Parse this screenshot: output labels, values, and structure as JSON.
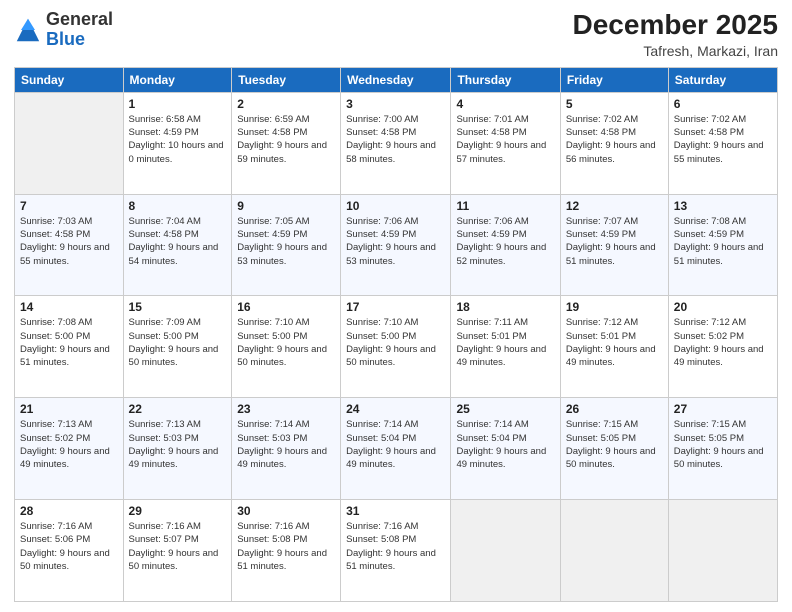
{
  "header": {
    "logo": {
      "general": "General",
      "blue": "Blue"
    },
    "title": "December 2025",
    "location": "Tafresh, Markazi, Iran"
  },
  "calendar": {
    "weekdays": [
      "Sunday",
      "Monday",
      "Tuesday",
      "Wednesday",
      "Thursday",
      "Friday",
      "Saturday"
    ],
    "weeks": [
      [
        {
          "day": "",
          "empty": true
        },
        {
          "day": "1",
          "sunrise": "6:58 AM",
          "sunset": "4:59 PM",
          "daylight": "10 hours and 0 minutes."
        },
        {
          "day": "2",
          "sunrise": "6:59 AM",
          "sunset": "4:58 PM",
          "daylight": "9 hours and 59 minutes."
        },
        {
          "day": "3",
          "sunrise": "7:00 AM",
          "sunset": "4:58 PM",
          "daylight": "9 hours and 58 minutes."
        },
        {
          "day": "4",
          "sunrise": "7:01 AM",
          "sunset": "4:58 PM",
          "daylight": "9 hours and 57 minutes."
        },
        {
          "day": "5",
          "sunrise": "7:02 AM",
          "sunset": "4:58 PM",
          "daylight": "9 hours and 56 minutes."
        },
        {
          "day": "6",
          "sunrise": "7:02 AM",
          "sunset": "4:58 PM",
          "daylight": "9 hours and 55 minutes."
        }
      ],
      [
        {
          "day": "7",
          "sunrise": "7:03 AM",
          "sunset": "4:58 PM",
          "daylight": "9 hours and 55 minutes."
        },
        {
          "day": "8",
          "sunrise": "7:04 AM",
          "sunset": "4:58 PM",
          "daylight": "9 hours and 54 minutes."
        },
        {
          "day": "9",
          "sunrise": "7:05 AM",
          "sunset": "4:59 PM",
          "daylight": "9 hours and 53 minutes."
        },
        {
          "day": "10",
          "sunrise": "7:06 AM",
          "sunset": "4:59 PM",
          "daylight": "9 hours and 53 minutes."
        },
        {
          "day": "11",
          "sunrise": "7:06 AM",
          "sunset": "4:59 PM",
          "daylight": "9 hours and 52 minutes."
        },
        {
          "day": "12",
          "sunrise": "7:07 AM",
          "sunset": "4:59 PM",
          "daylight": "9 hours and 51 minutes."
        },
        {
          "day": "13",
          "sunrise": "7:08 AM",
          "sunset": "4:59 PM",
          "daylight": "9 hours and 51 minutes."
        }
      ],
      [
        {
          "day": "14",
          "sunrise": "7:08 AM",
          "sunset": "5:00 PM",
          "daylight": "9 hours and 51 minutes."
        },
        {
          "day": "15",
          "sunrise": "7:09 AM",
          "sunset": "5:00 PM",
          "daylight": "9 hours and 50 minutes."
        },
        {
          "day": "16",
          "sunrise": "7:10 AM",
          "sunset": "5:00 PM",
          "daylight": "9 hours and 50 minutes."
        },
        {
          "day": "17",
          "sunrise": "7:10 AM",
          "sunset": "5:00 PM",
          "daylight": "9 hours and 50 minutes."
        },
        {
          "day": "18",
          "sunrise": "7:11 AM",
          "sunset": "5:01 PM",
          "daylight": "9 hours and 49 minutes."
        },
        {
          "day": "19",
          "sunrise": "7:12 AM",
          "sunset": "5:01 PM",
          "daylight": "9 hours and 49 minutes."
        },
        {
          "day": "20",
          "sunrise": "7:12 AM",
          "sunset": "5:02 PM",
          "daylight": "9 hours and 49 minutes."
        }
      ],
      [
        {
          "day": "21",
          "sunrise": "7:13 AM",
          "sunset": "5:02 PM",
          "daylight": "9 hours and 49 minutes."
        },
        {
          "day": "22",
          "sunrise": "7:13 AM",
          "sunset": "5:03 PM",
          "daylight": "9 hours and 49 minutes."
        },
        {
          "day": "23",
          "sunrise": "7:14 AM",
          "sunset": "5:03 PM",
          "daylight": "9 hours and 49 minutes."
        },
        {
          "day": "24",
          "sunrise": "7:14 AM",
          "sunset": "5:04 PM",
          "daylight": "9 hours and 49 minutes."
        },
        {
          "day": "25",
          "sunrise": "7:14 AM",
          "sunset": "5:04 PM",
          "daylight": "9 hours and 49 minutes."
        },
        {
          "day": "26",
          "sunrise": "7:15 AM",
          "sunset": "5:05 PM",
          "daylight": "9 hours and 50 minutes."
        },
        {
          "day": "27",
          "sunrise": "7:15 AM",
          "sunset": "5:05 PM",
          "daylight": "9 hours and 50 minutes."
        }
      ],
      [
        {
          "day": "28",
          "sunrise": "7:16 AM",
          "sunset": "5:06 PM",
          "daylight": "9 hours and 50 minutes."
        },
        {
          "day": "29",
          "sunrise": "7:16 AM",
          "sunset": "5:07 PM",
          "daylight": "9 hours and 50 minutes."
        },
        {
          "day": "30",
          "sunrise": "7:16 AM",
          "sunset": "5:08 PM",
          "daylight": "9 hours and 51 minutes."
        },
        {
          "day": "31",
          "sunrise": "7:16 AM",
          "sunset": "5:08 PM",
          "daylight": "9 hours and 51 minutes."
        },
        {
          "day": "",
          "empty": true
        },
        {
          "day": "",
          "empty": true
        },
        {
          "day": "",
          "empty": true
        }
      ]
    ]
  }
}
